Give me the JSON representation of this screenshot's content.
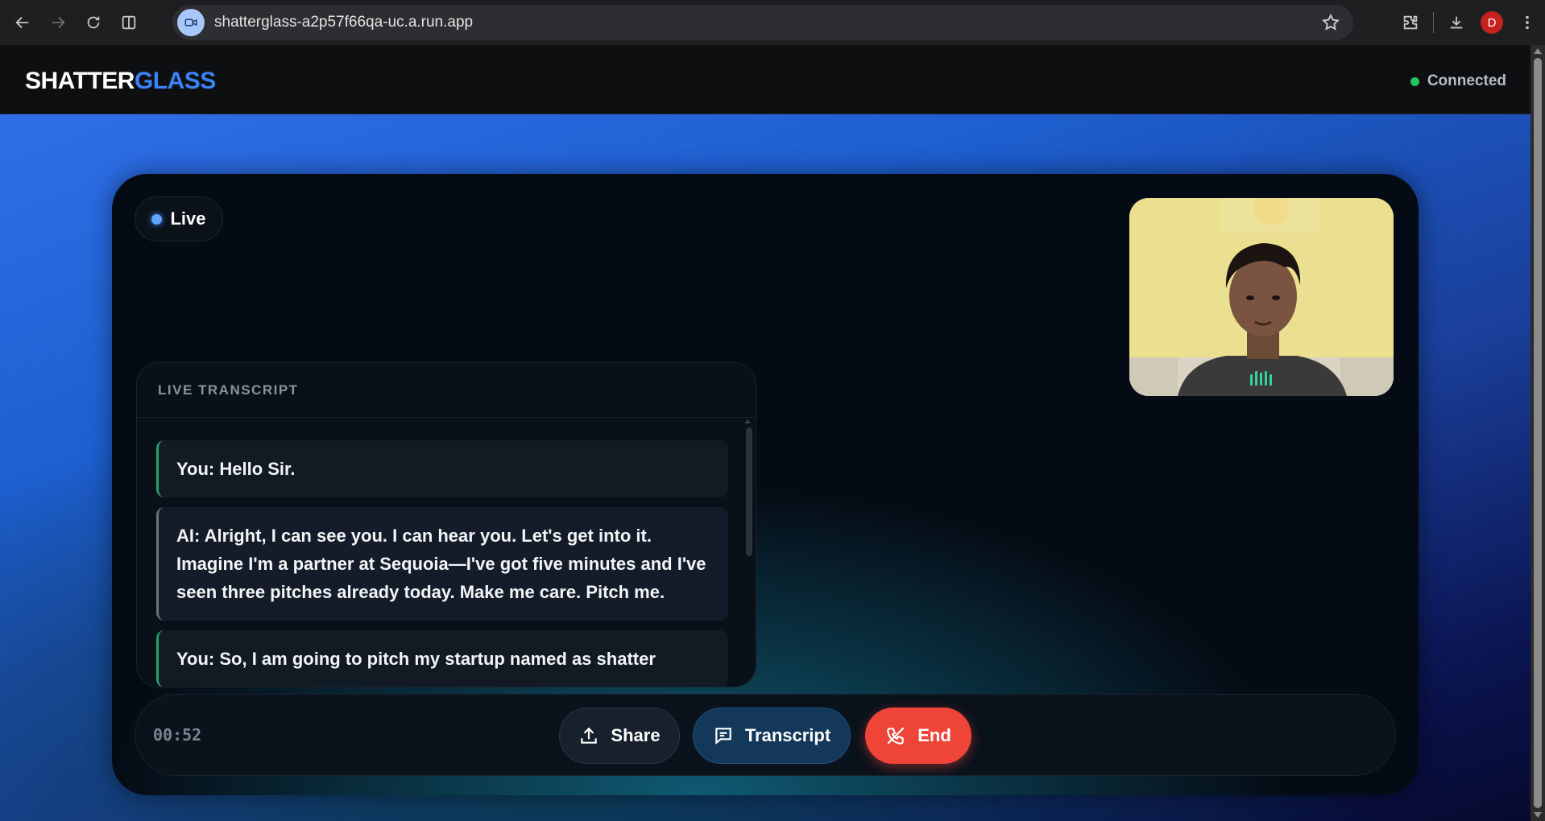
{
  "browser": {
    "url": "shatterglass-a2p57f66qa-uc.a.run.app",
    "profile_initial": "D"
  },
  "app": {
    "brand_part1": "SHATTER",
    "brand_part2": "GLASS",
    "status_text": "Connected",
    "colors": {
      "brand_accent": "#3b82f6",
      "status_ok": "#22c55e",
      "end": "#ef4438"
    }
  },
  "call": {
    "live_label": "Live",
    "timer": "00:52"
  },
  "transcript": {
    "title": "LIVE TRANSCRIPT",
    "messages": [
      {
        "speaker": "you",
        "text": "You: Hello Sir."
      },
      {
        "speaker": "ai",
        "text": "AI: Alright, I can see you. I can hear you. Let's get into it. Imagine I'm a partner at Sequoia—I've got five minutes and I've seen three pitches already today. Make me care. Pitch me."
      },
      {
        "speaker": "you",
        "text": "You: So, I am going to pitch my startup named as shatter"
      }
    ]
  },
  "controls": {
    "share_label": "Share",
    "transcript_label": "Transcript",
    "end_label": "End"
  }
}
